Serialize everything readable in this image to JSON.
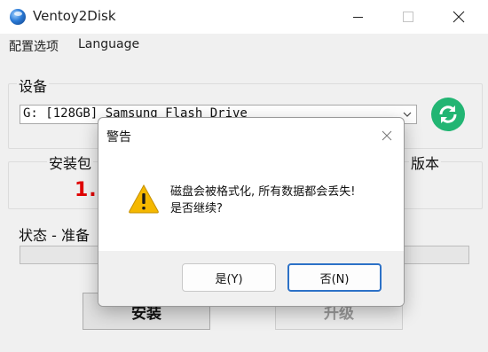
{
  "window": {
    "title": "Ventoy2Disk",
    "icon": "ventoy-globe-icon"
  },
  "menu": {
    "items": [
      "配置选项",
      "Language"
    ]
  },
  "device": {
    "group_label": "设备",
    "selected": "G: [128GB] Samsung Flash Drive",
    "refresh_icon": "refresh-icon"
  },
  "versions": {
    "package_label": "安装包",
    "package_value": "1.",
    "device_label": "版本"
  },
  "status": {
    "label": "状态 - 准备"
  },
  "buttons": {
    "install": "安装",
    "upgrade": "升级"
  },
  "dialog": {
    "title": "警告",
    "message_line1": "磁盘会被格式化, 所有数据都会丢失!",
    "message_line2": "是否继续?",
    "yes_label": "是(Y)",
    "no_label": "否(N)",
    "icon": "warning-icon"
  },
  "colors": {
    "accent": "#2c71c7",
    "refresh": "#22b573",
    "version_text": "#e00000",
    "warning": "#f5b800"
  }
}
